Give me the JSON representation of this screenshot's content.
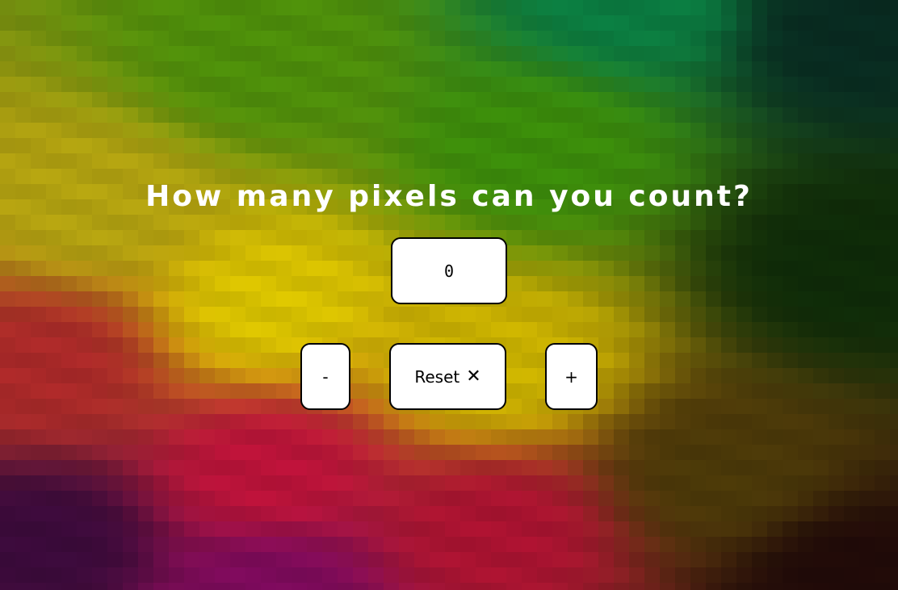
{
  "heading": "How many pixels can you count?",
  "counter": {
    "value": "0"
  },
  "buttons": {
    "decrement_label": "-",
    "reset_label": "Reset",
    "reset_icon": "close-icon",
    "increment_label": "+"
  },
  "colors": {
    "panel_background": "#ffffff",
    "panel_border": "#000000",
    "heading_text": "#ffffff",
    "background_gradient": [
      "#0d7a3a",
      "#5a9a10",
      "#d8c400",
      "#c0261e",
      "#b0103a",
      "#2a0e40"
    ]
  }
}
